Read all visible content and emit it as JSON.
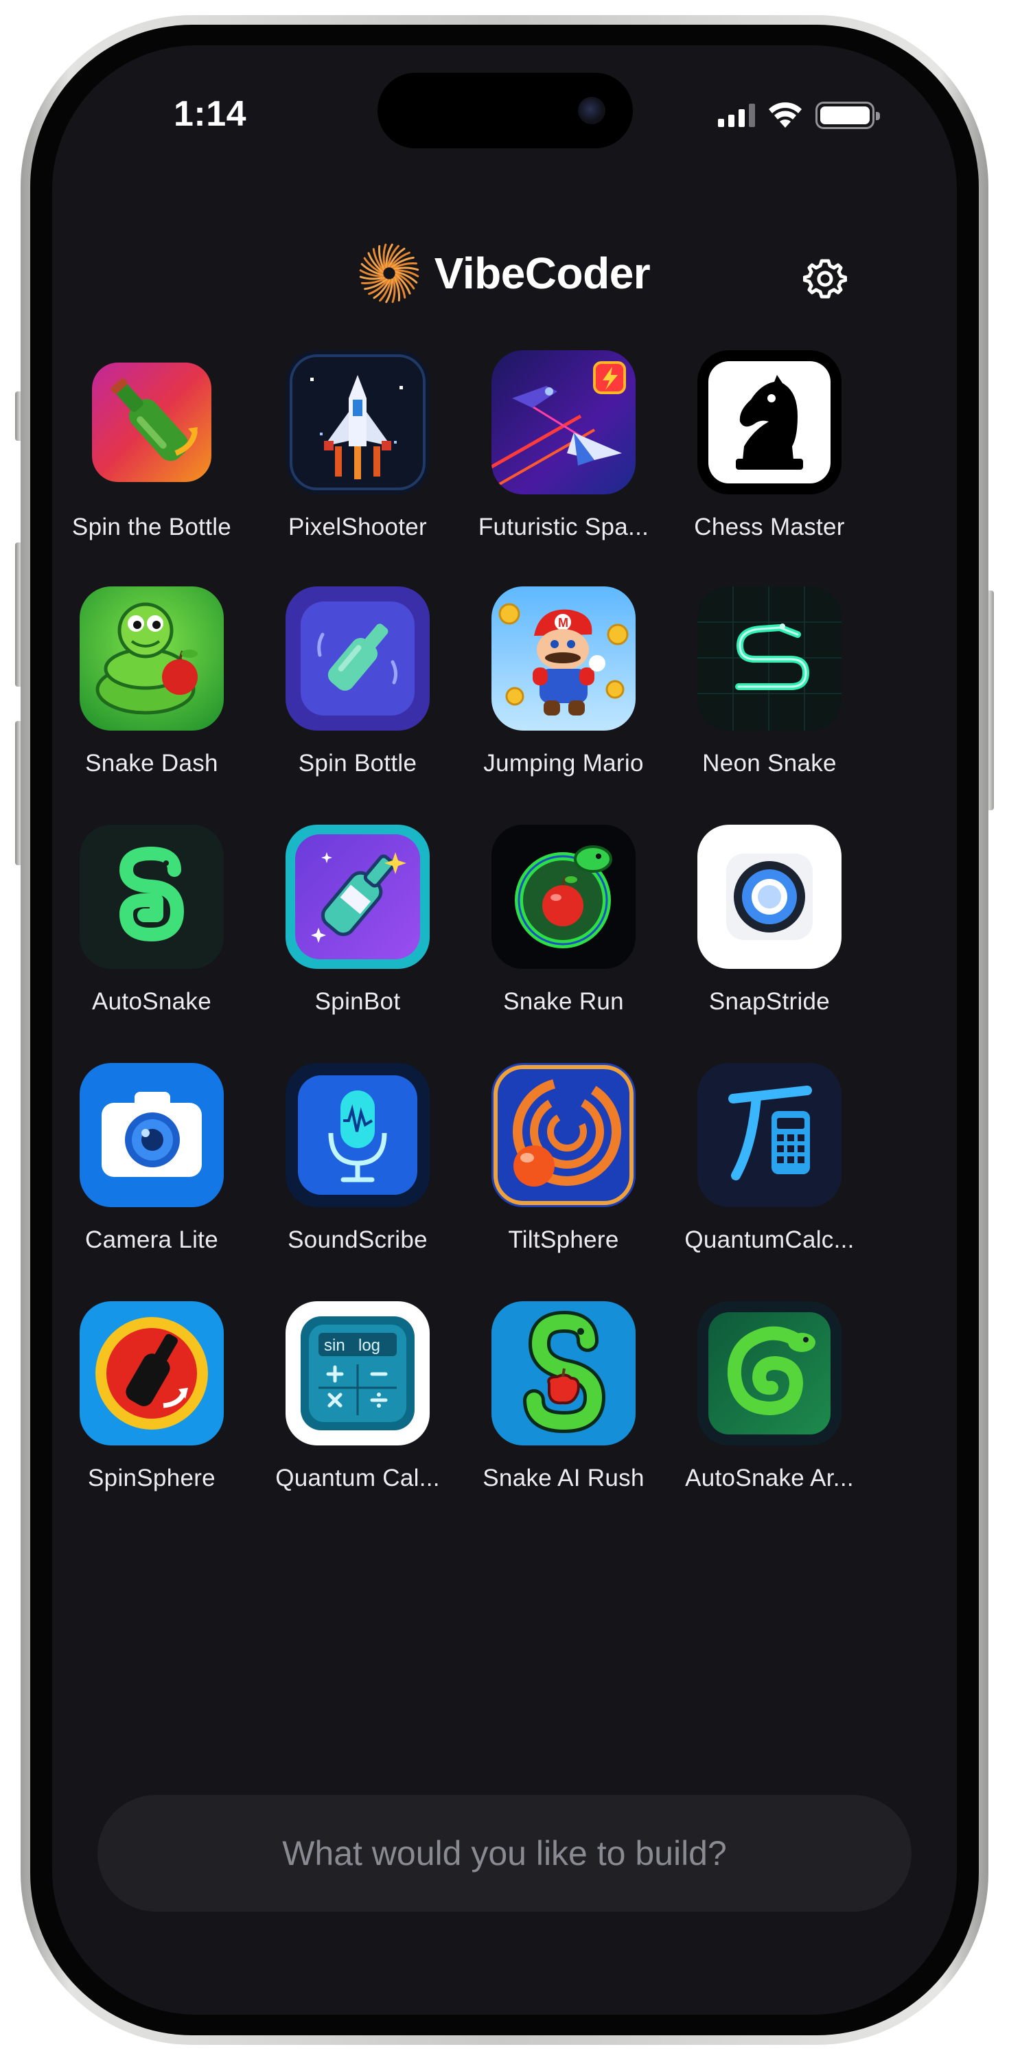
{
  "status_bar": {
    "time": "1:14",
    "signal_icon": "cellular-signal-icon",
    "wifi_icon": "wifi-icon",
    "battery_icon": "battery-icon"
  },
  "header": {
    "title": "VibeCoder",
    "logo_icon": "sunburst-logo-icon",
    "settings_icon": "gear-icon"
  },
  "apps": [
    {
      "label": "Spin the Bottle",
      "icon": "bottle-spin-icon"
    },
    {
      "label": "PixelShooter",
      "icon": "pixel-spaceship-icon"
    },
    {
      "label": "Futuristic Spa...",
      "icon": "space-fighter-icon"
    },
    {
      "label": "Chess Master",
      "icon": "chess-knight-icon"
    },
    {
      "label": "Snake Dash",
      "icon": "cartoon-snake-apple-icon"
    },
    {
      "label": "Spin Bottle",
      "icon": "bottle-icon"
    },
    {
      "label": "Jumping Mario",
      "icon": "mario-character-icon"
    },
    {
      "label": "Neon Snake",
      "icon": "neon-snake-icon"
    },
    {
      "label": "AutoSnake",
      "icon": "green-snake-icon"
    },
    {
      "label": "SpinBot",
      "icon": "sparkle-bottle-icon"
    },
    {
      "label": "Snake Run",
      "icon": "snake-apple-ring-icon"
    },
    {
      "label": "SnapStride",
      "icon": "camera-lens-icon"
    },
    {
      "label": "Camera Lite",
      "icon": "camera-icon"
    },
    {
      "label": "SoundScribe",
      "icon": "microphone-icon"
    },
    {
      "label": "TiltSphere",
      "icon": "maze-ball-icon"
    },
    {
      "label": "QuantumCalc...",
      "icon": "pi-calculator-icon"
    },
    {
      "label": "SpinSphere",
      "icon": "bottle-circle-icon"
    },
    {
      "label": "Quantum Cal...",
      "icon": "scientific-calculator-icon"
    },
    {
      "label": "Snake AI Rush",
      "icon": "snake-apple-icon"
    },
    {
      "label": "AutoSnake Ar...",
      "icon": "spiral-snake-icon"
    }
  ],
  "prompt": {
    "placeholder": "What would you like to build?"
  }
}
